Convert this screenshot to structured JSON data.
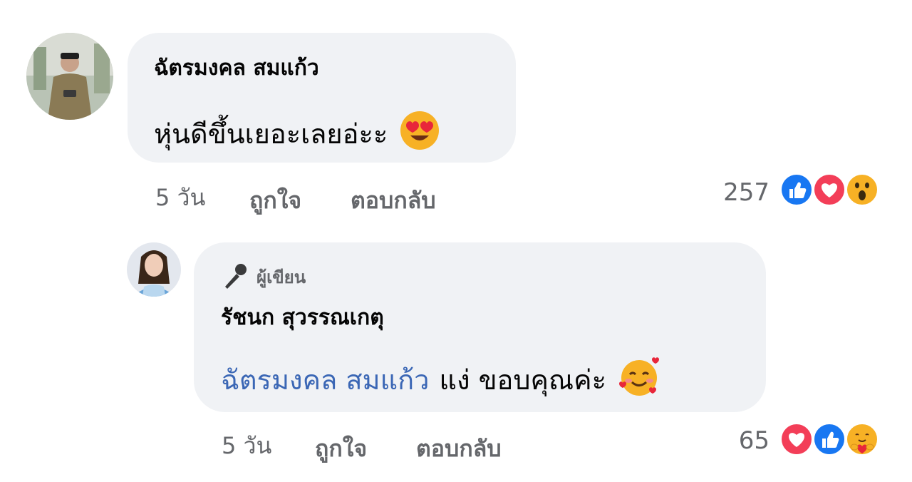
{
  "comments": [
    {
      "author": "ฉัตรมงคล สมแก้ว",
      "text": "หุ่นดีขึ้นเยอะเลยอ่ะะ",
      "text_emoji": "heart-eyes-emoji",
      "time": "5 วัน",
      "like_label": "ถูกใจ",
      "reply_label": "ตอบกลับ",
      "reaction_count": "257",
      "reactions": [
        "like-icon",
        "love-icon",
        "wow-icon"
      ]
    },
    {
      "badge": "ผู้เขียน",
      "badge_icon": "microphone-icon",
      "author": "รัชนก สุวรรณเกตุ",
      "mention": "ฉัตรมงคล สมแก้ว",
      "text": "แง่ ขอบคุณค่ะ",
      "text_emoji": "smiling-face-with-hearts-emoji",
      "time": "5 วัน",
      "like_label": "ถูกใจ",
      "reply_label": "ตอบกลับ",
      "reaction_count": "65",
      "reactions": [
        "love-icon",
        "like-icon",
        "care-icon"
      ]
    }
  ],
  "colors": {
    "bubble": "#f0f2f5",
    "mention": "#3b67b5",
    "like": "#1877f2",
    "love": "#f33e58",
    "wow": "#f7b125",
    "meta": "#65676b"
  }
}
